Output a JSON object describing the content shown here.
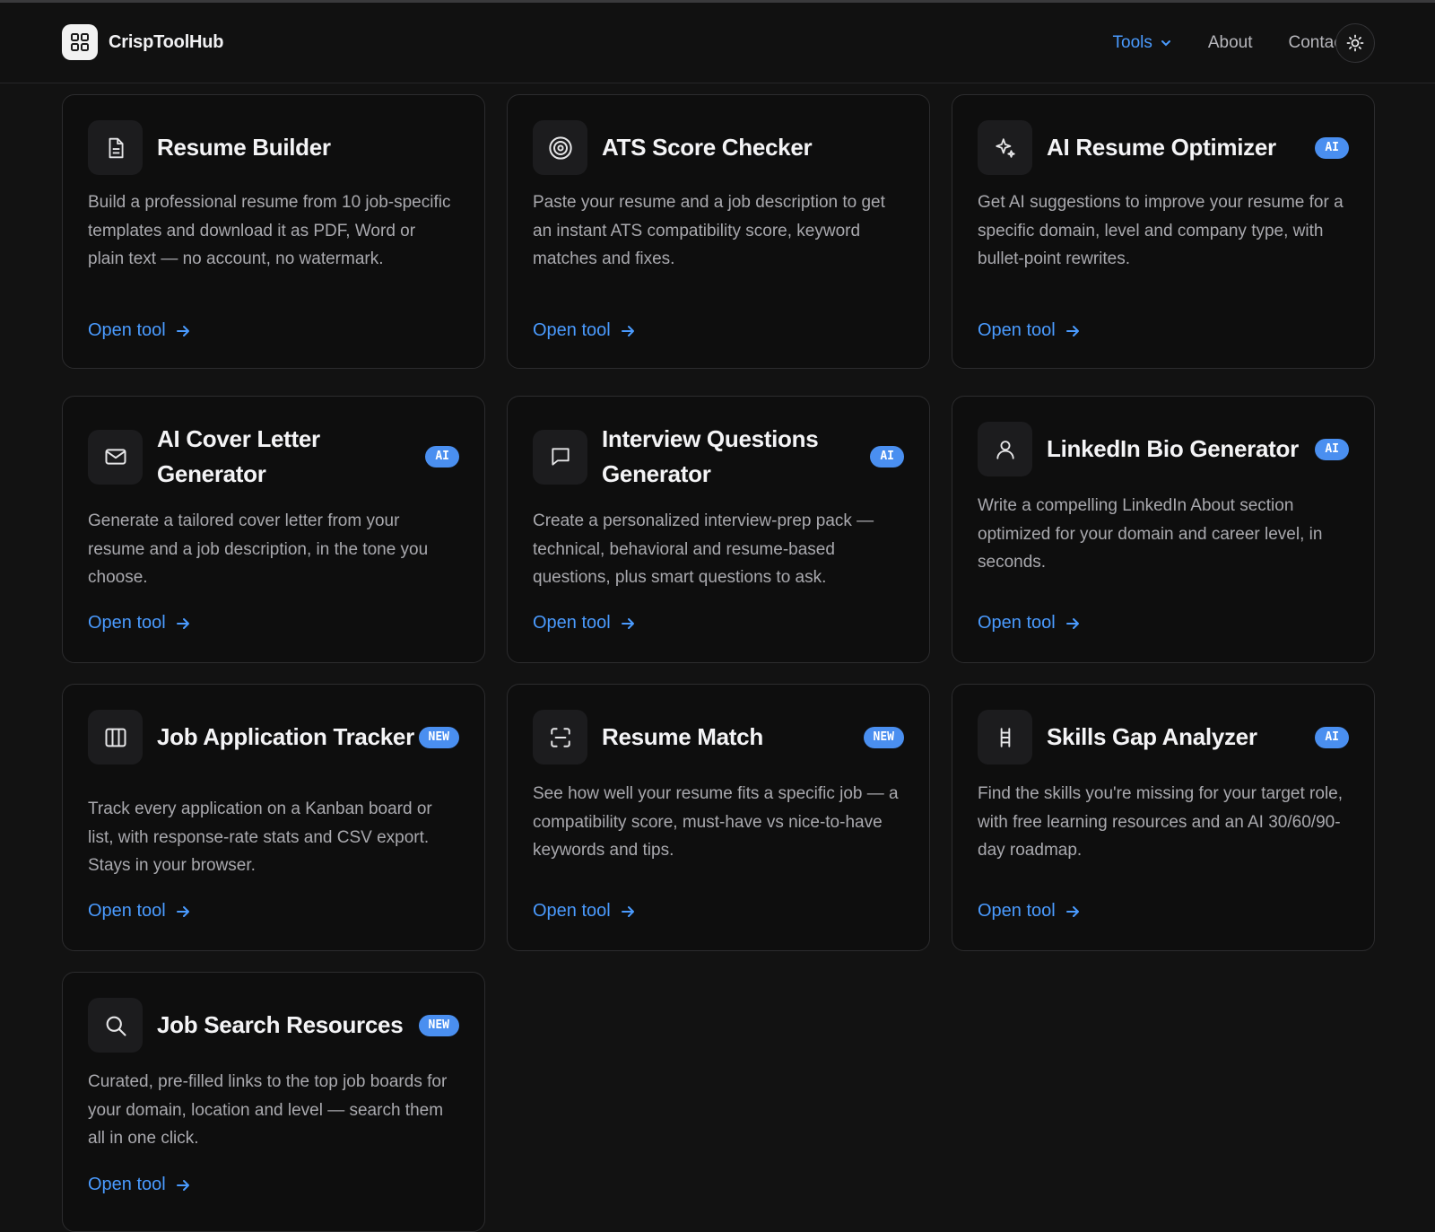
{
  "brand": {
    "name": "CrispToolHub"
  },
  "nav": {
    "tools": "Tools",
    "about": "About",
    "contact": "Contact"
  },
  "cards": [
    {
      "title": "Resume Builder",
      "badge": "",
      "desc": "Build a professional resume from 10 job-specific templates and download it as PDF, Word or plain text — no account, no watermark.",
      "link": "Open tool",
      "icon": "document-icon"
    },
    {
      "title": "ATS Score Checker",
      "badge": "",
      "desc": "Paste your resume and a job description to get an instant ATS compatibility score, keyword matches and fixes.",
      "link": "Open tool",
      "icon": "target-icon"
    },
    {
      "title": "AI Resume Optimizer",
      "badge": "AI",
      "desc": "Get AI suggestions to improve your resume for a specific domain, level and company type, with bullet-point rewrites.",
      "link": "Open tool",
      "icon": "sparkle-icon"
    },
    {
      "title": "AI Cover Letter Generator",
      "badge": "AI",
      "desc": "Generate a tailored cover letter from your resume and a job description, in the tone you choose.",
      "link": "Open tool",
      "icon": "mail-icon"
    },
    {
      "title": "Interview Questions Generator",
      "badge": "AI",
      "desc": "Create a personalized interview-prep pack — technical, behavioral and resume-based questions, plus smart questions to ask.",
      "link": "Open tool",
      "icon": "chat-icon"
    },
    {
      "title": "LinkedIn Bio Generator",
      "badge": "AI",
      "desc": "Write a compelling LinkedIn About section optimized for your domain and career level, in seconds.",
      "link": "Open tool",
      "icon": "user-icon"
    },
    {
      "title": "Job Application Tracker",
      "badge": "NEW",
      "desc": "Track every application on a Kanban board or list, with response-rate stats and CSV export. Stays in your browser.",
      "link": "Open tool",
      "icon": "columns-icon"
    },
    {
      "title": "Resume Match",
      "badge": "NEW",
      "desc": "See how well your resume fits a specific job — a compatibility score, must-have vs nice-to-have keywords and tips.",
      "link": "Open tool",
      "icon": "scan-icon"
    },
    {
      "title": "Skills Gap Analyzer",
      "badge": "AI",
      "desc": "Find the skills you're missing for your target role, with free learning resources and an AI 30/60/90-day roadmap.",
      "link": "Open tool",
      "icon": "ladder-icon"
    },
    {
      "title": "Job Search Resources",
      "badge": "NEW",
      "desc": "Curated, pre-filled links to the top job boards for your domain, location and level — search them all in one click.",
      "link": "Open tool",
      "icon": "search-icon"
    }
  ]
}
